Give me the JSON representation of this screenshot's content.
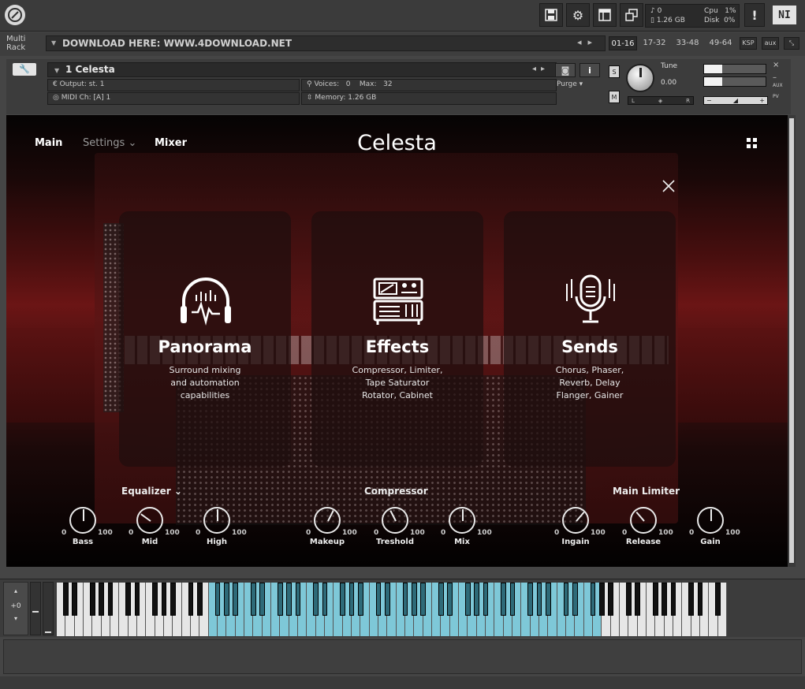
{
  "header": {
    "stats_voices": "0",
    "stats_memory": "1.26 GB",
    "stats_cpu_label": "Cpu",
    "stats_cpu": "1%",
    "stats_disk_label": "Disk",
    "stats_disk": "0%",
    "warning": "!",
    "ni_logo": "NI"
  },
  "rack": {
    "label_line1": "Multi",
    "label_line2": "Rack",
    "preset": "DOWNLOAD HERE: WWW.4DOWNLOAD.NET",
    "page_tabs": [
      "01-16",
      "17-32",
      "33-48",
      "49-64"
    ],
    "ksp": "KSP",
    "aux": "aux"
  },
  "instrument": {
    "name": "1 Celesta",
    "output_label": "Output:",
    "output_value": "st. 1",
    "voices_label": "Voices:",
    "voices_value": "0",
    "max_label": "Max:",
    "max_value": "32",
    "midi_label": "MIDI Ch:",
    "midi_value": "[A] 1",
    "memory_label": "Memory:",
    "memory_value": "1.26 GB",
    "purge": "Purge",
    "solo": "S",
    "mute": "M",
    "tune_label": "Tune",
    "tune_value": "0.00",
    "pan_left": "L",
    "pan_right": "R",
    "aux_label": "AUX",
    "pv_label": "PV",
    "vol_minus": "−",
    "vol_plus": "+"
  },
  "panel": {
    "nav": [
      "Main",
      "Settings",
      "Mixer"
    ],
    "title": "Celesta",
    "cards": [
      {
        "title": "Panorama",
        "desc": "Surround mixing\nand automation\ncapabilities",
        "icon": "headphones-icon"
      },
      {
        "title": "Effects",
        "desc": "Compressor, Limiter,\nTape Saturator\nRotator, Cabinet",
        "icon": "rack-icon"
      },
      {
        "title": "Sends",
        "desc": "Chorus, Phaser,\nReverb, Delay\nFlanger, Gainer",
        "icon": "microphone-icon"
      }
    ],
    "sections": {
      "equalizer": "Equalizer",
      "compressor": "Compressor",
      "limiter": "Main Limiter"
    },
    "knob_min": "0",
    "knob_max": "100",
    "knobs": [
      {
        "label": "Bass",
        "value": 50
      },
      {
        "label": "Mid",
        "value": 30
      },
      {
        "label": "High",
        "value": 50
      },
      {
        "label": "Makeup",
        "value": 60
      },
      {
        "label": "Treshold",
        "value": 40
      },
      {
        "label": "Mix",
        "value": 50
      },
      {
        "label": "Ingain",
        "value": 65
      },
      {
        "label": "Release",
        "value": 35
      },
      {
        "label": "Gain",
        "value": 50
      }
    ]
  },
  "keyboard": {
    "octave": "+0",
    "white_keys": 75,
    "highlight_start": 17,
    "highlight_end": 61
  },
  "colors": {
    "key_highlight": "#7ec8d8",
    "panel_red": "#6b1515"
  }
}
